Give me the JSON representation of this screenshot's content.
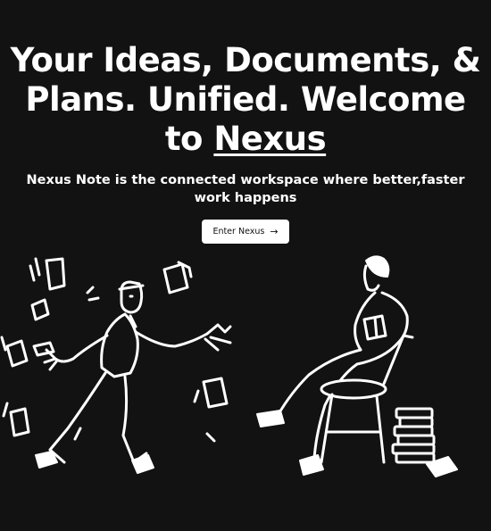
{
  "hero": {
    "headline_line_1": "Your Ideas, Documents, &",
    "headline_line_2": "Plans. Unified. Welcome",
    "headline_prefix": "to ",
    "headline_brand": "Nexus",
    "subtitle": "Nexus Note is the connected workspace where better,faster work happens",
    "cta_label": "Enter Nexus",
    "cta_icon": "arrow-right-icon"
  },
  "colors": {
    "background": "#121212",
    "text": "#ffffff",
    "button_bg": "#ffffff",
    "button_text": "#111111"
  }
}
